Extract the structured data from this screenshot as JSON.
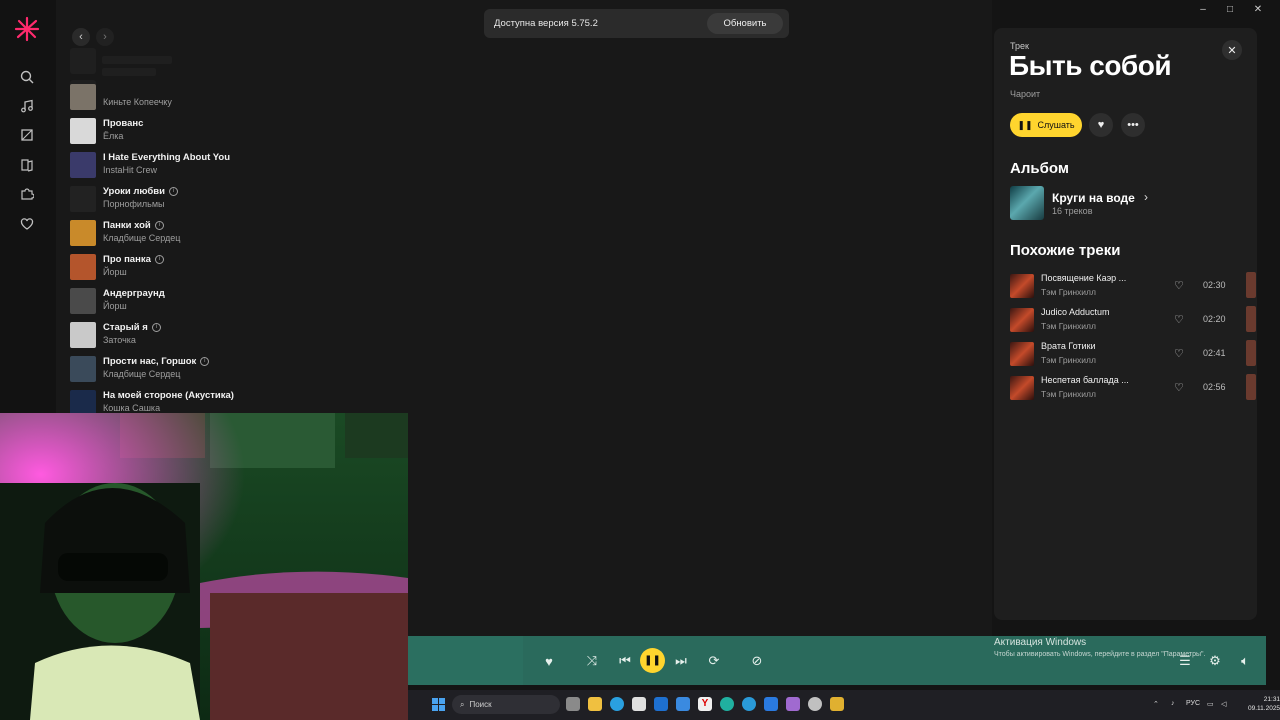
{
  "window": {
    "minimize": "–",
    "maximize": "□",
    "close": "✕"
  },
  "nav": {
    "back": "‹",
    "forward": "›",
    "rail_icons": [
      "search-icon",
      "music-note-icon",
      "collection-icon",
      "podcast-book-icon",
      "puzzle-icon",
      "heart-icon"
    ]
  },
  "update_banner": {
    "text": "Доступна версия 5.75.2",
    "button": "Обновить"
  },
  "tracks": [
    {
      "title": "",
      "artist": "Киньте Копеечку",
      "info": false,
      "cover": "#7b7368"
    },
    {
      "title": "Прованс",
      "artist": "Ёлка",
      "info": false,
      "cover": "#d9d9d9"
    },
    {
      "title": "I Hate Everything About You",
      "artist": "InstaHit Crew",
      "info": false,
      "cover": "#3a3a6a"
    },
    {
      "title": "Уроки любви",
      "artist": "Порнофильмы",
      "info": true,
      "cover": "#222222"
    },
    {
      "title": "Панки хой",
      "artist": "Кладбище Сердец",
      "info": true,
      "cover": "#c98a2a"
    },
    {
      "title": "Про панка",
      "artist": "Йорш",
      "info": true,
      "cover": "#b4552c"
    },
    {
      "title": "Андерграунд",
      "artist": "Йорш",
      "info": false,
      "cover": "#4a4a4a"
    },
    {
      "title": "Старый я",
      "artist": "Заточка",
      "info": true,
      "cover": "#c9c9c9"
    },
    {
      "title": "Прости нас, Горшок",
      "artist": "Кладбище Сердец",
      "info": true,
      "cover": "#3a4a5a"
    },
    {
      "title": "На моей стороне (Акустика)",
      "artist": "Кошка Сашка",
      "info": false,
      "cover": "#1a2a4a"
    }
  ],
  "track_panel": {
    "kicker": "Трек",
    "title": "Быть собой",
    "artist": "Чароит",
    "play_label": "Слушать",
    "album_heading": "Альбом",
    "album_title": "Круги на воде",
    "album_tracks": "16 треков",
    "similar_heading": "Похожие треки",
    "similar": [
      {
        "title": "Посвящение Каэр ...",
        "artist": "Тэм Гринхилл",
        "duration": "02:30"
      },
      {
        "title": "Judico Adductum",
        "artist": "Тэм Гринхилл",
        "duration": "02:20"
      },
      {
        "title": "Врата Готики",
        "artist": "Тэм Гринхилл",
        "duration": "02:41"
      },
      {
        "title": "Неспетая баллада ...",
        "artist": "Тэм Гринхилл",
        "duration": "02:56"
      }
    ]
  },
  "player": {
    "state": "playing",
    "icons": [
      "heart-icon",
      "shuffle-icon",
      "previous-icon",
      "pause-icon",
      "next-icon",
      "repeat-icon",
      "dislike-icon",
      "queue-icon",
      "equalizer-icon",
      "volume-icon"
    ]
  },
  "activation": {
    "title": "Активация Windows",
    "subtitle": "Чтобы активировать Windows, перейдите в раздел \"Параметры\"."
  },
  "taskbar": {
    "search_placeholder": "Поиск",
    "lang": "РУС",
    "time": "21:31",
    "date": "09.11.2025"
  },
  "colors": {
    "accent_yellow": "#ffd52e",
    "player_bg": "#2a6a5c",
    "logo": "#ff2a6d"
  }
}
